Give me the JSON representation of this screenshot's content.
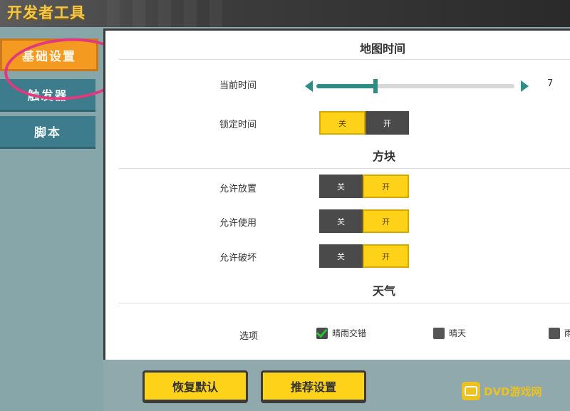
{
  "header": {
    "title": "开发者工具"
  },
  "sidebar": {
    "tabs": [
      {
        "label": "基础设置",
        "active": true
      },
      {
        "label": "触发器",
        "active": false
      },
      {
        "label": "脚本",
        "active": false
      }
    ]
  },
  "map_time": {
    "title": "地图时间",
    "current_time_label": "当前时间",
    "current_time_value": "7",
    "slider_fraction": 0.3,
    "lock_time_label": "锁定时间",
    "lock_time": {
      "off": "关",
      "on": "开",
      "selected": "off"
    }
  },
  "blocks": {
    "title": "方块",
    "rows": [
      {
        "label": "允许放置",
        "off": "关",
        "on": "开",
        "selected": "on"
      },
      {
        "label": "允许使用",
        "off": "关",
        "on": "开",
        "selected": "on"
      },
      {
        "label": "允许破坏",
        "off": "关",
        "on": "开",
        "selected": "on"
      }
    ]
  },
  "weather": {
    "title": "天气",
    "options_label": "选项",
    "options": [
      {
        "label": "晴雨交错",
        "checked": true
      },
      {
        "label": "晴天",
        "checked": false
      },
      {
        "label": "雨",
        "checked": false
      }
    ]
  },
  "footer": {
    "restore_label": "恢复默认",
    "recommend_label": "推荐设置"
  },
  "watermark": {
    "text": "DVD游戏网"
  },
  "colors": {
    "accent_yellow": "#ffd21a",
    "active_tab_orange": "#f59a21",
    "tab_teal": "#3d7c8c",
    "slider_teal": "#2f8c84",
    "highlight_pink": "#e0397d"
  }
}
